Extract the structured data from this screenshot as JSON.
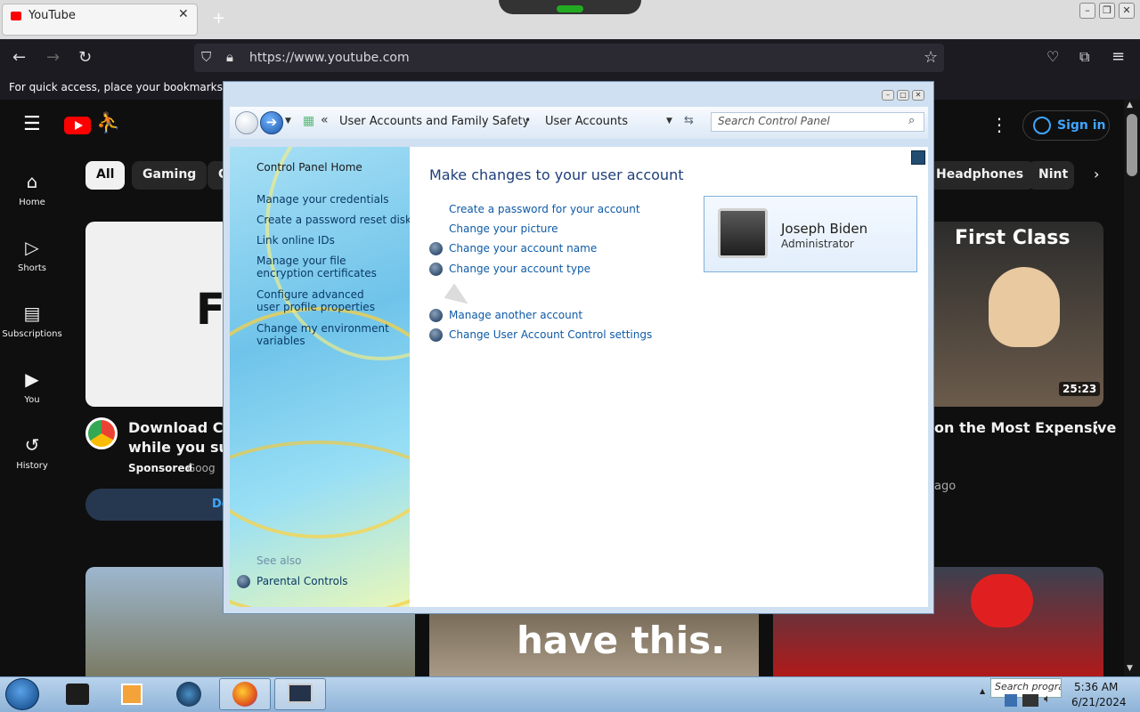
{
  "browser": {
    "tab_title": "YouTube",
    "url": "https://www.youtube.com",
    "bookmarks_hint": "For quick access, place your bookmarks here o"
  },
  "youtube": {
    "chips": [
      "All",
      "Gaming",
      "G",
      "Headphones",
      "Nint"
    ],
    "sidebar": [
      {
        "label": "Home",
        "icon": "home-icon"
      },
      {
        "label": "Shorts",
        "icon": "shorts-icon"
      },
      {
        "label": "Subscriptions",
        "icon": "subscriptions-icon"
      },
      {
        "label": "You",
        "icon": "you-icon"
      },
      {
        "label": "History",
        "icon": "history-icon"
      }
    ],
    "sign_in": "Sign in",
    "ad_title_line1": "Download Chro",
    "ad_title_line2": "while you surf.",
    "ad_sponsored": "Sponsored",
    "ad_source": "Goog",
    "ad_button": "Do",
    "thumb_text_left": "Fa",
    "video_title": "on the Most Expensive",
    "video_meta": "ago",
    "thumb_overlay": "First Class",
    "thumb_duration": "25:23",
    "bottom_thumb_text": "have this."
  },
  "control_panel": {
    "breadcrumb": [
      "User Accounts and Family Safety",
      "User Accounts"
    ],
    "search_placeholder": "Search Control Panel",
    "left_links": [
      "Control Panel Home",
      "Manage your credentials",
      "Create a password reset disk",
      "Link online IDs",
      "Manage your file encryption certificates",
      "Configure advanced user profile properties",
      "Change my environment variables"
    ],
    "see_also": "See also",
    "see_also_links": [
      "Parental Controls"
    ],
    "heading": "Make changes to your user account",
    "tasks": [
      "Create a password for your account",
      "Change your picture",
      "Change your account name",
      "Change your account type",
      "Manage another account",
      "Change User Account Control settings"
    ],
    "account_name": "Joseph Biden",
    "account_role": "Administrator"
  },
  "taskbar": {
    "search_placeholder": "Search progra",
    "time": "5:36 AM",
    "date": "6/21/2024"
  }
}
